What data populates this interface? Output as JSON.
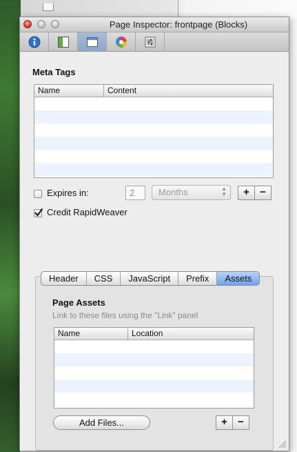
{
  "window": {
    "title": "Page Inspector: frontpage (Blocks)"
  },
  "toolbar": {
    "buttons": [
      {
        "icon": "info-icon"
      },
      {
        "icon": "page-layout-icon"
      },
      {
        "icon": "window-icon",
        "active": true
      },
      {
        "icon": "color-wheel-icon"
      },
      {
        "icon": "sliders-icon"
      }
    ]
  },
  "meta_tags": {
    "heading": "Meta Tags",
    "columns": [
      "Name",
      "Content"
    ],
    "rows": []
  },
  "expires": {
    "label": "Expires in:",
    "checked": false,
    "value": "2",
    "unit": "Months"
  },
  "credit": {
    "label": "Credit RapidWeaver",
    "checked": true
  },
  "tabs": {
    "items": [
      "Header",
      "CSS",
      "JavaScript",
      "Prefix",
      "Assets"
    ],
    "selected": "Assets"
  },
  "assets": {
    "heading": "Page Assets",
    "hint": "Link to these files using the \"Link\" panel",
    "columns": [
      "Name",
      "Location"
    ],
    "rows": [],
    "add_files_label": "Add Files..."
  },
  "controls": {
    "plus": "+",
    "minus": "−"
  },
  "colors": {
    "accent": "#6fa2ee",
    "row_alt": "#edf3fe"
  }
}
